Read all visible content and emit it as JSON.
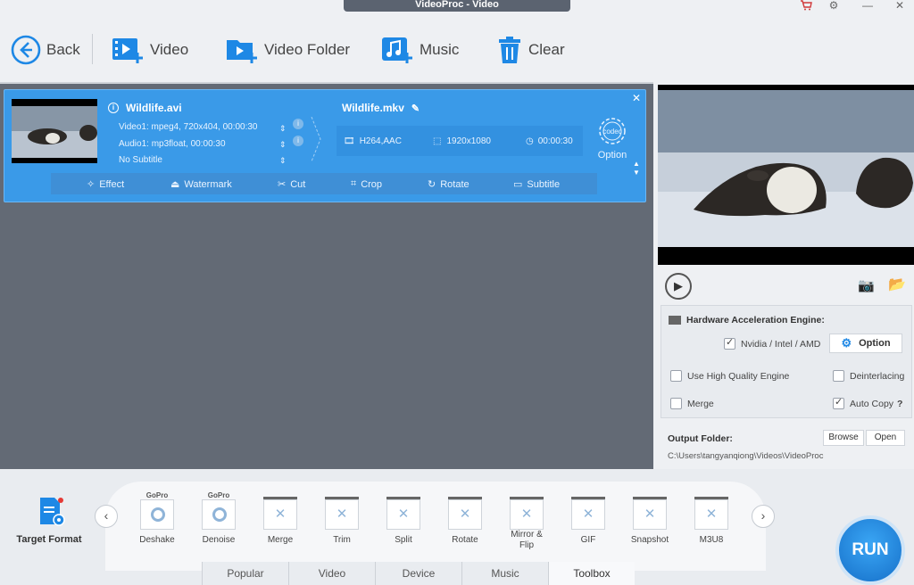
{
  "window": {
    "title": "VideoProc - Video"
  },
  "toolbar": {
    "back": "Back",
    "video": "Video",
    "video_folder": "Video Folder",
    "music": "Music",
    "clear": "Clear"
  },
  "item": {
    "source_name": "Wildlife.avi",
    "video_track": "Video1: mpeg4, 720x404, 00:00:30",
    "audio_track": "Audio1: mp3float, 00:00:30",
    "subtitle": "No Subtitle",
    "target_name": "Wildlife.mkv",
    "codec_info": "H264,AAC",
    "resolution": "1920x1080",
    "duration": "00:00:30",
    "codec_label": "codec",
    "option_label": "Option",
    "edit": {
      "effect": "Effect",
      "watermark": "Watermark",
      "cut": "Cut",
      "crop": "Crop",
      "rotate": "Rotate",
      "subtitle": "Subtitle"
    }
  },
  "settings": {
    "hw_title": "Hardware Acceleration Engine:",
    "nvidia": "Nvidia / Intel / AMD",
    "nvidia_checked": true,
    "option": "Option",
    "high_quality": "Use High Quality Engine",
    "high_quality_checked": false,
    "deinterlacing": "Deinterlacing",
    "deinterlacing_checked": false,
    "merge": "Merge",
    "merge_checked": false,
    "auto_copy": "Auto Copy",
    "auto_copy_checked": true,
    "help": "?"
  },
  "output": {
    "label": "Output Folder:",
    "browse": "Browse",
    "open": "Open",
    "path": "C:\\Users\\tangyanqiong\\Videos\\VideoProc"
  },
  "bottom": {
    "target_format": "Target Format",
    "formats": [
      {
        "label": "Deshake",
        "brand": "GoPro"
      },
      {
        "label": "Denoise",
        "brand": "GoPro"
      },
      {
        "label": "Merge",
        "brand": ""
      },
      {
        "label": "Trim",
        "brand": ""
      },
      {
        "label": "Split",
        "brand": ""
      },
      {
        "label": "Rotate",
        "brand": ""
      },
      {
        "label": "Mirror & Flip",
        "brand": ""
      },
      {
        "label": "GIF",
        "brand": ""
      },
      {
        "label": "Snapshot",
        "brand": ""
      },
      {
        "label": "M3U8",
        "brand": ""
      }
    ],
    "tabs": [
      "Popular",
      "Video",
      "Device",
      "Music",
      "Toolbox"
    ],
    "active_tab": "Toolbox",
    "run": "RUN"
  },
  "colors": {
    "accent": "#3a9ae8",
    "list_bg": "#636a75",
    "run": "#1e87dc"
  }
}
